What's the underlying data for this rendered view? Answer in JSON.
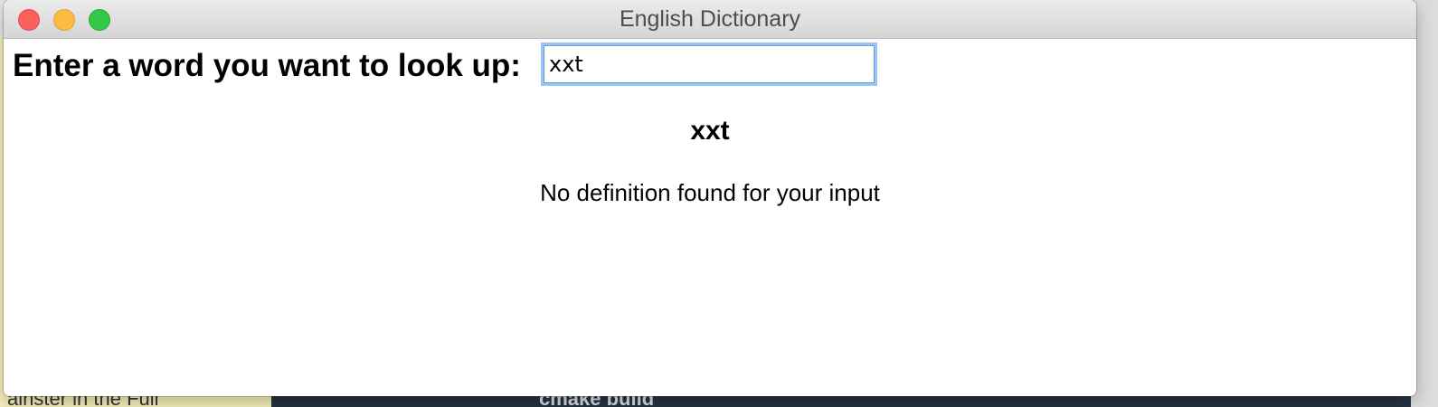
{
  "window": {
    "title": "English Dictionary"
  },
  "search": {
    "label": "Enter a word you want to look up:",
    "value": "xxt"
  },
  "result": {
    "word": "xxt",
    "message": "No definition found for your input"
  },
  "background": {
    "terminal_text": "cmake build",
    "left_text": "ainster in the Full"
  },
  "colors": {
    "close": "#fc605c",
    "minimize": "#fdbc40",
    "zoom": "#34c84a",
    "input_focus": "#9dc3f0"
  }
}
